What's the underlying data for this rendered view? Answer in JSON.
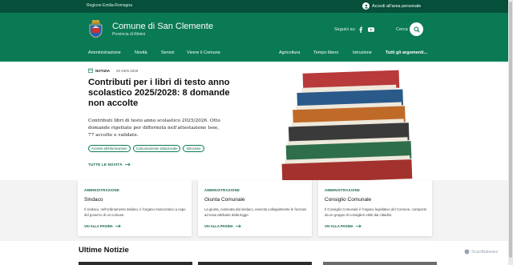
{
  "topbar": {
    "region": "Regione Emilia-Romagna",
    "login_label": "Accedi all'area personale"
  },
  "header": {
    "title": "Comune di San Clemente",
    "subtitle": "Provincia di Rimini",
    "social_label": "Seguici su:",
    "search_label": "Cerca"
  },
  "nav": {
    "items": [
      "Amministrazione",
      "Novità",
      "Servizi",
      "Vivere il Comune"
    ],
    "secondary": [
      "Agricoltura",
      "Tempo libero",
      "Istruzione",
      "Tutti gli argomenti..."
    ]
  },
  "hero": {
    "tag": "NOTIZIA",
    "date": "20 GEN 2026",
    "title": "Contributi per i libri di testo anno scolastico 2025/2028: 8 domande non accolte",
    "description": "Contributi libri di testo anno scolastico 2025/2026. Otto domande rigettate per difformità nell'attestazione Isee, 77 accolte e validate.",
    "chips": [
      "Accessi all'informazione",
      "Comunicazione istituzionale",
      "Istruzione"
    ],
    "all_news": "TUTTE LE NOVITÀ"
  },
  "cards": [
    {
      "category": "AMMINISTRAZIONE",
      "title": "Sindaco",
      "text": "Il sindaco, nell'ordinamento italiano, è l'organo monocratico a capo del governo di un comune.",
      "link": "VAI ALLA PAGINA"
    },
    {
      "category": "AMMINISTRAZIONE",
      "title": "Giunta Comunale",
      "text": "La giunta, nominata dal sindaco, esercita collegialmente le funzioni ad essa attribuite dalla legge.",
      "link": "VAI ALLA PAGINA"
    },
    {
      "category": "AMMINISTRAZIONE",
      "title": "Consiglio Comunale",
      "text": "Il Consiglio Comunale è l'organo legislativo del Comune, composto da un gruppo di consiglieri eletti dai cittadini.",
      "link": "VAI ALLA PAGINA"
    }
  ],
  "latest": {
    "heading": "Ultime Notizie"
  },
  "watermark": "ScanMalware",
  "colors": {
    "primary": "#0a7a55",
    "dark": "#064f3a"
  },
  "icons": [
    "user-icon",
    "crest-icon",
    "facebook-icon",
    "youtube-icon",
    "search-icon",
    "calendar-icon",
    "arrow-right-icon"
  ]
}
